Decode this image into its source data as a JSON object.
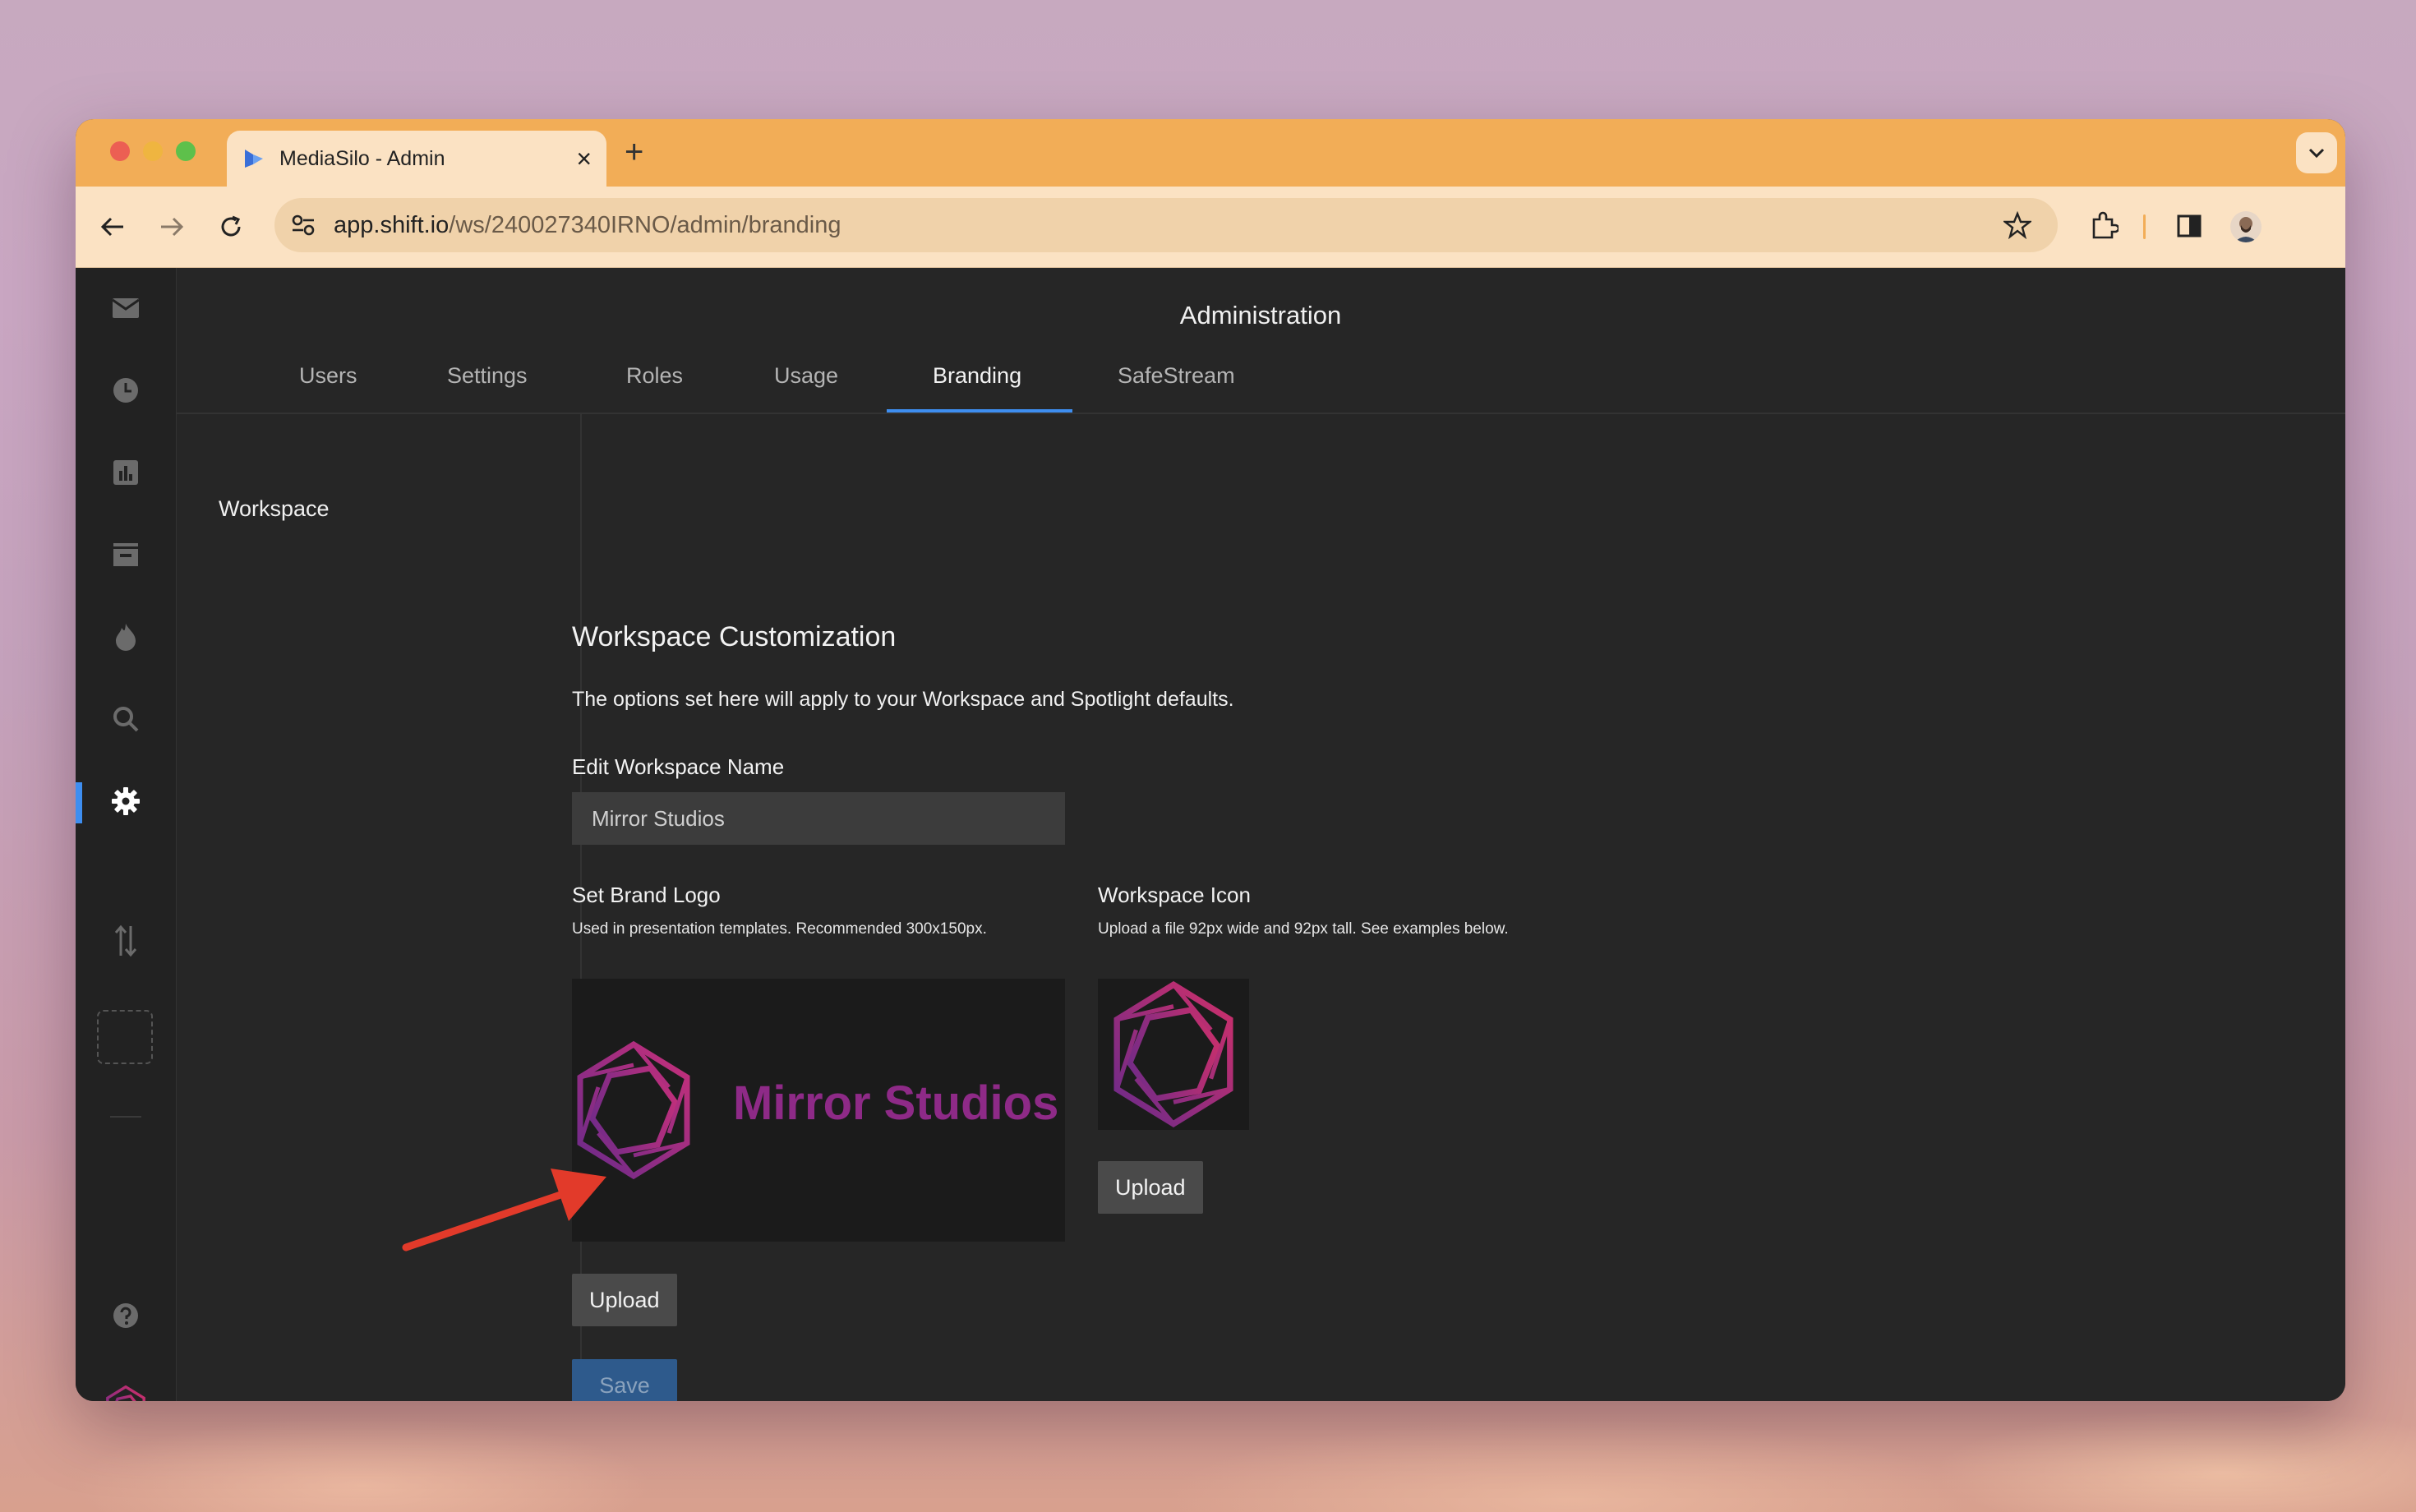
{
  "browser": {
    "tab_title": "MediaSilo - Admin",
    "new_tab": "+",
    "close": "×",
    "url_host": "app.shift.io",
    "url_path": "/ws/240027340IRNO/admin/branding"
  },
  "page": {
    "title": "Administration",
    "tabs": [
      {
        "label": "Users"
      },
      {
        "label": "Settings"
      },
      {
        "label": "Roles"
      },
      {
        "label": "Usage"
      },
      {
        "label": "Branding",
        "active": true
      },
      {
        "label": "SafeStream"
      }
    ],
    "subnav": {
      "items": [
        {
          "label": "Workspace"
        }
      ]
    }
  },
  "branding": {
    "heading": "Workspace Customization",
    "description": "The options set here will apply to your Workspace and Spotlight defaults.",
    "name_label": "Edit Workspace Name",
    "name_value": "Mirror Studios",
    "logo_label": "Set Brand Logo",
    "logo_hint": "Used in presentation templates. Recommended 300x150px.",
    "logo_text": "Mirror Studios",
    "icon_label": "Workspace Icon",
    "icon_hint": "Upload a file 92px wide and 92px tall. See examples below.",
    "upload_label": "Upload",
    "save_label": "Save"
  },
  "colors": {
    "accent": "#3e8ef0",
    "brand_magenta": "#8e2a87",
    "annotation_arrow": "#e23a2a"
  },
  "icons": {
    "rail": [
      "inbox-icon",
      "clock-icon",
      "bar-chart-icon",
      "archive-icon",
      "flame-icon",
      "search-icon",
      "gear-icon",
      "transfer-icon",
      "help-icon"
    ]
  }
}
